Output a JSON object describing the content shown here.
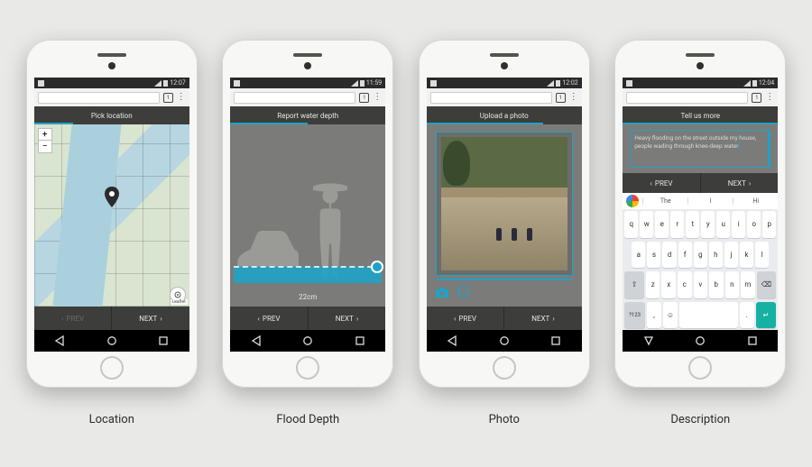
{
  "captions": {
    "location": "Location",
    "depth": "Flood Depth",
    "photo": "Photo",
    "description": "Description"
  },
  "status": {
    "time1": "12:07",
    "time2": "11:59",
    "time3": "12:02",
    "time4": "12:04"
  },
  "browser": {
    "tab_count": "1"
  },
  "nav": {
    "prev": "PREV",
    "next": "NEXT"
  },
  "screen1": {
    "title": "Pick location",
    "zoom_in": "+",
    "zoom_out": "−",
    "attrib": "Leaflet"
  },
  "screen2": {
    "title": "Report water depth",
    "depth_value": "22cm"
  },
  "screen3": {
    "title": "Upload a photo"
  },
  "screen4": {
    "title": "Tell us more",
    "entered_text": "Heavy flooding on the street outside my house, people wading through knee-deep water",
    "suggestions": [
      "The",
      "I",
      "Hi"
    ],
    "kb_rows": {
      "r1": [
        "q",
        "w",
        "e",
        "r",
        "t",
        "y",
        "u",
        "i",
        "o",
        "p"
      ],
      "r2": [
        "a",
        "s",
        "d",
        "f",
        "g",
        "h",
        "j",
        "k",
        "l"
      ],
      "r3_shift": "⇧",
      "r3": [
        "z",
        "x",
        "c",
        "v",
        "b",
        "n",
        "m"
      ],
      "r3_back": "⌫",
      "r4_sym": "?123",
      "r4_comma": ",",
      "r4_emoji": "☺",
      "r4_period": ".",
      "r4_enter": "↵"
    }
  }
}
